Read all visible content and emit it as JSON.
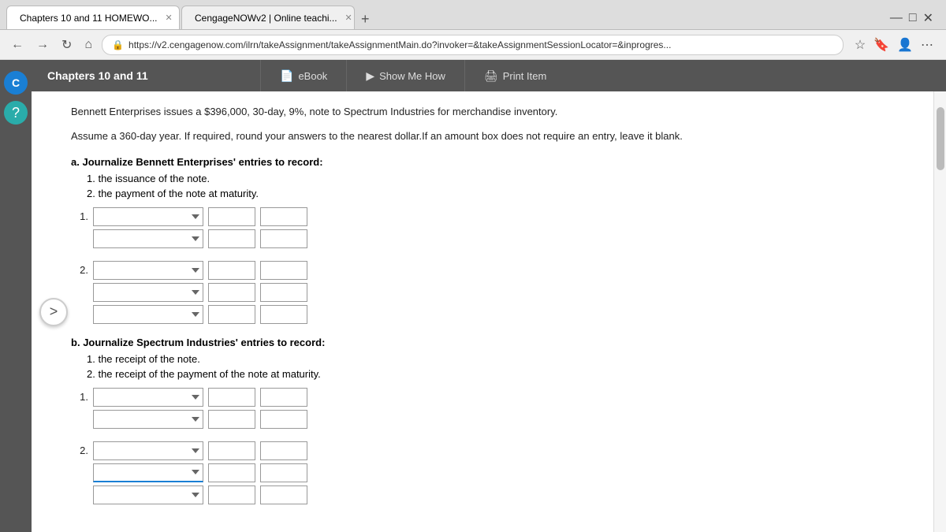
{
  "browser": {
    "tabs": [
      {
        "id": "tab1",
        "label": "Chapters 10 and 11 HOMEWO...",
        "icon_type": "red",
        "active": true
      },
      {
        "id": "tab2",
        "label": "CengageNOWv2 | Online teachi...",
        "icon_type": "blue",
        "active": false
      }
    ],
    "address": "https://v2.cengagenow.com/ilrn/takeAssignment/takeAssignmentMain.do?invoker=&takeAssignmentSessionLocator=&inprogres...",
    "window_controls": [
      "—",
      "□",
      "✕"
    ]
  },
  "header": {
    "chapter_title": "Chapters 10 and 11",
    "tabs": [
      {
        "label": "eBook",
        "icon": "📄"
      },
      {
        "label": "Show Me How",
        "icon": "▶"
      },
      {
        "label": "Print Item",
        "icon": "🖨"
      }
    ]
  },
  "content": {
    "intro_text": "Bennett Enterprises issues a $396,000, 30-day, 9%, note to Spectrum Industries for merchandise inventory.",
    "instruction_text": "Assume a 360-day year. If required, round your answers to the nearest dollar.If an amount box does not require an entry, leave it blank.",
    "section_a": {
      "label": "a.",
      "instruction": "Journalize Bennett Enterprises' entries to record:",
      "sub_items": [
        "1. the issuance of the note.",
        "2. the payment of the note at maturity."
      ],
      "entry_groups": [
        {
          "number": "1.",
          "rows": [
            {
              "has_number": true
            },
            {
              "has_number": false
            }
          ]
        },
        {
          "number": "2.",
          "rows": [
            {
              "has_number": true
            },
            {
              "has_number": false
            },
            {
              "has_number": false
            }
          ]
        }
      ]
    },
    "section_b": {
      "label": "b.",
      "instruction": "Journalize Spectrum Industries' entries to record:",
      "sub_items": [
        "1. the receipt of the note.",
        "2. the receipt of the payment of the note at maturity."
      ],
      "entry_groups": [
        {
          "number": "1.",
          "rows": [
            {
              "has_number": true
            },
            {
              "has_number": false
            }
          ]
        },
        {
          "number": "2.",
          "rows": [
            {
              "has_number": true
            },
            {
              "has_number": false
            },
            {
              "has_number": false
            }
          ]
        }
      ]
    }
  },
  "side_nav": {
    "icons": [
      {
        "label": "C",
        "type": "blue"
      },
      {
        "label": "?",
        "type": "teal"
      }
    ]
  }
}
